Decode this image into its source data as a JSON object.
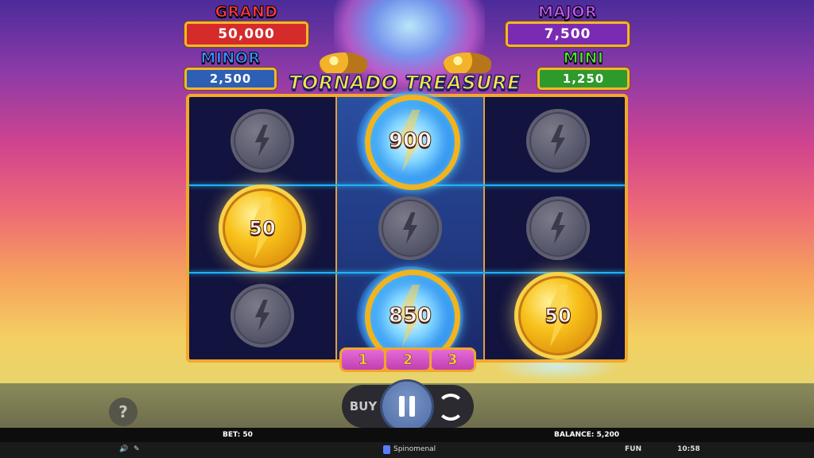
{
  "jackpots": {
    "grand": {
      "label": "GRAND",
      "value": "50,000",
      "color": "#d62b2b",
      "label_color": "#ff3b3b"
    },
    "major": {
      "label": "MAJOR",
      "value": "7,500",
      "color": "#7b2bb3",
      "label_color": "#c257ff"
    },
    "minor": {
      "label": "MINOR",
      "value": "2,500",
      "color": "#2c5fb5",
      "label_color": "#3c8cff"
    },
    "mini": {
      "label": "MINI",
      "value": "1,250",
      "color": "#2e9a2c",
      "label_color": "#53dd3a"
    }
  },
  "title": "TORNADO TREASURE",
  "reels": [
    [
      {
        "type": "blank"
      },
      {
        "type": "gold",
        "value": "50"
      },
      {
        "type": "blank"
      }
    ],
    [
      {
        "type": "electric",
        "value": "900"
      },
      {
        "type": "blank"
      },
      {
        "type": "electric",
        "value": "850"
      }
    ],
    [
      {
        "type": "blank"
      },
      {
        "type": "blank"
      },
      {
        "type": "gold",
        "value": "50"
      }
    ]
  ],
  "respins": [
    "1",
    "2",
    "3"
  ],
  "controls": {
    "help": "?",
    "buy": "BUY"
  },
  "status": {
    "bet": "BET: 50",
    "balance": "BALANCE: 5,200"
  },
  "footer": {
    "brand": "Spinomenal",
    "mode": "FUN",
    "time": "10:58"
  }
}
